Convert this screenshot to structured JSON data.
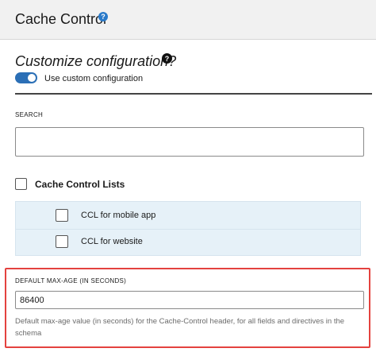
{
  "header": {
    "title": "Cache Control",
    "help_icon": "question-circle-icon",
    "help_glyph": "?"
  },
  "customize": {
    "title": "Customize configuration?",
    "help_icon": "question-circle-icon",
    "help_glyph": "?",
    "toggle_on": true,
    "toggle_label": "Use custom configuration"
  },
  "search": {
    "label": "SEARCH",
    "value": "",
    "placeholder": ""
  },
  "ccl": {
    "label": "Cache Control Lists",
    "checked": false,
    "items": [
      {
        "label": "CCL for mobile app",
        "checked": false
      },
      {
        "label": "CCL for website",
        "checked": false
      }
    ]
  },
  "max_age": {
    "label": "DEFAULT MAX-AGE (IN SECONDS)",
    "value": "86400",
    "help": "Default max-age value (in seconds) for the Cache-Control header, for all fields and directives in the schema"
  },
  "colors": {
    "accent": "#2b6fb6",
    "highlight_border": "#e4423f",
    "sublist_bg": "#e6f1f8"
  }
}
